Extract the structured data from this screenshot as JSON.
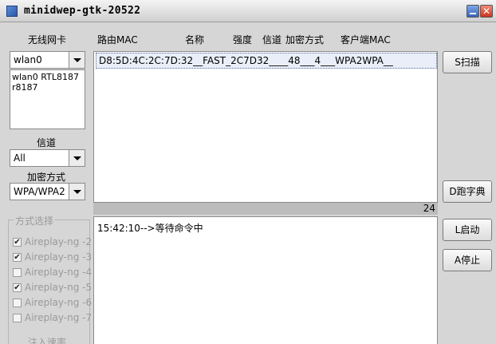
{
  "window": {
    "title": "minidwep-gtk-20522"
  },
  "left": {
    "wireless_card_label": "无线网卡",
    "card_select": "wlan0",
    "card_info": "wlan0 RTL8187 r8187",
    "channel_label": "信道",
    "channel_select": "All",
    "encryption_label": "加密方式",
    "encryption_select": "WPA/WPA2",
    "mode_group": {
      "title": "方式选择",
      "items": [
        {
          "label": "Aireplay-ng -2",
          "checked": true,
          "mark": "✔"
        },
        {
          "label": "Aireplay-ng -3",
          "checked": true,
          "mark": "✔"
        },
        {
          "label": "Aireplay-ng -4",
          "checked": false,
          "mark": ""
        },
        {
          "label": "Aireplay-ng -5",
          "checked": true,
          "mark": "✔"
        },
        {
          "label": "Aireplay-ng -6",
          "checked": false,
          "mark": ""
        },
        {
          "label": "Aireplay-ng -7",
          "checked": false,
          "mark": ""
        }
      ]
    },
    "inject_rate_label": "注入速率"
  },
  "columns": {
    "router_mac": "路由MAC",
    "name": "名称",
    "strength": "强度",
    "channel": "信道",
    "encryption": "加密方式",
    "client_mac": "客户端MAC"
  },
  "ap_list": [
    {
      "text": "D8:5D:4C:2C:7D:32__FAST_2C7D32____48___4___WPA2WPA__"
    }
  ],
  "count": "24",
  "log": "15:42:10-->等待命令中",
  "buttons": {
    "scan": "S扫描",
    "dictionary": "D跑字典",
    "start": "L启动",
    "stop": "A停止"
  }
}
